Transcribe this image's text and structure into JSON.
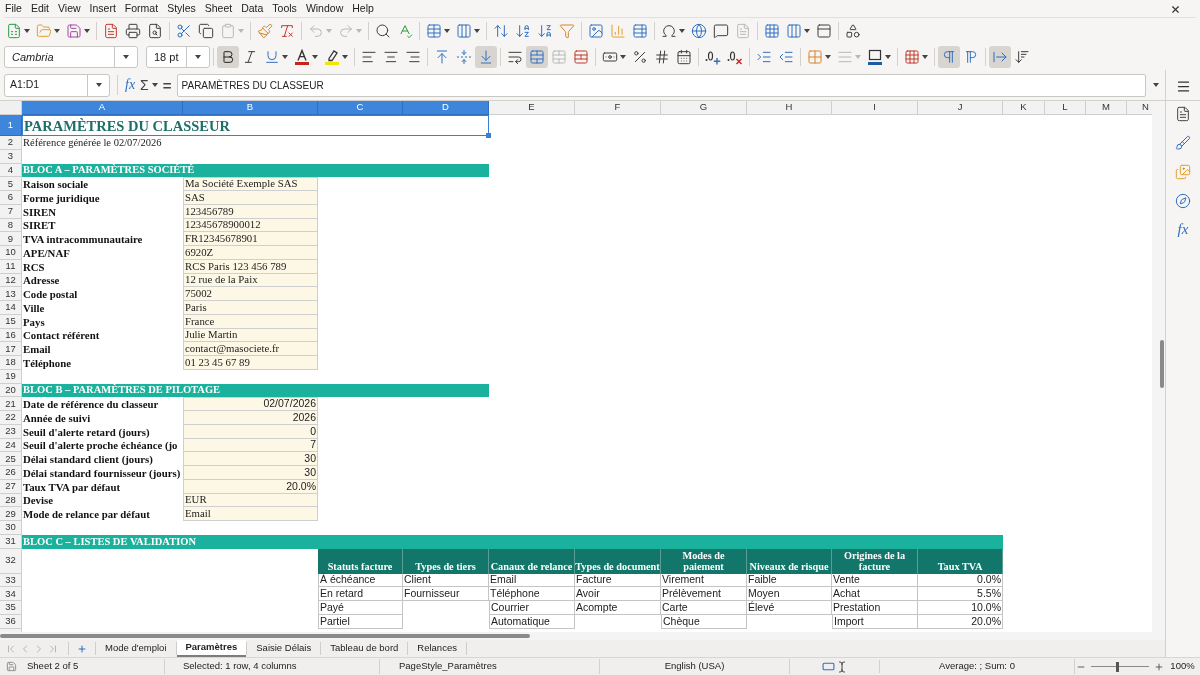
{
  "menu_bar": [
    "File",
    "Edit",
    "View",
    "Insert",
    "Format",
    "Styles",
    "Sheet",
    "Data",
    "Tools",
    "Window",
    "Help"
  ],
  "format_toolbar": {
    "font_name": "Cambria",
    "font_size": "18 pt",
    "toggles": {
      "bold": true,
      "italic": false,
      "underline": false,
      "align_left": false,
      "align_center": false,
      "align_right": false,
      "align_top": false,
      "align_middle": false,
      "align_bottom": true,
      "wrap_text": false,
      "merge_and_center": true,
      "left_to_right": true,
      "right_to_left": false,
      "text_left_to_right": true,
      "text_top_to_bottom": false
    }
  },
  "formula_bar": {
    "name_box": "A1:D1",
    "function_wizard": "fx",
    "sum": "Σ",
    "equals": "=",
    "content": "PARAMÈTRES DU CLASSEUR"
  },
  "sidebar": {
    "functions": "fx"
  },
  "sheet": {
    "columns": [
      {
        "label": "A",
        "selected": true
      },
      {
        "label": "B",
        "selected": true
      },
      {
        "label": "C",
        "selected": true
      },
      {
        "label": "D",
        "selected": true
      },
      {
        "label": "E",
        "selected": false
      },
      {
        "label": "F",
        "selected": false
      },
      {
        "label": "G",
        "selected": false
      },
      {
        "label": "H",
        "selected": false
      },
      {
        "label": "I",
        "selected": false
      },
      {
        "label": "J",
        "selected": false
      },
      {
        "label": "K",
        "selected": false
      },
      {
        "label": "L",
        "selected": false
      },
      {
        "label": "M",
        "selected": false
      },
      {
        "label": "N",
        "selected": false
      }
    ],
    "rows": [
      {
        "label": "1",
        "selected": true
      },
      {
        "label": "2",
        "selected": false
      },
      {
        "label": "3",
        "selected": false
      },
      {
        "label": "4",
        "selected": false
      },
      {
        "label": "5",
        "selected": false
      },
      {
        "label": "6",
        "selected": false
      },
      {
        "label": "7",
        "selected": false
      },
      {
        "label": "8",
        "selected": false
      },
      {
        "label": "9",
        "selected": false
      },
      {
        "label": "10",
        "selected": false
      },
      {
        "label": "11",
        "selected": false
      },
      {
        "label": "12",
        "selected": false
      },
      {
        "label": "13",
        "selected": false
      },
      {
        "label": "14",
        "selected": false
      },
      {
        "label": "15",
        "selected": false
      },
      {
        "label": "16",
        "selected": false
      },
      {
        "label": "17",
        "selected": false
      },
      {
        "label": "18",
        "selected": false
      },
      {
        "label": "19",
        "selected": false
      },
      {
        "label": "20",
        "selected": false
      },
      {
        "label": "21",
        "selected": false
      },
      {
        "label": "22",
        "selected": false
      },
      {
        "label": "23",
        "selected": false
      },
      {
        "label": "24",
        "selected": false
      },
      {
        "label": "25",
        "selected": false
      },
      {
        "label": "26",
        "selected": false
      },
      {
        "label": "27",
        "selected": false
      },
      {
        "label": "28",
        "selected": false
      },
      {
        "label": "29",
        "selected": false
      },
      {
        "label": "30",
        "selected": false
      },
      {
        "label": "31",
        "selected": false
      },
      {
        "label": "32",
        "selected": false
      },
      {
        "label": "33",
        "selected": false
      },
      {
        "label": "34",
        "selected": false
      },
      {
        "label": "35",
        "selected": false
      },
      {
        "label": "36",
        "selected": false
      }
    ],
    "title": {
      "text": "PARAMÈTRES DU CLASSEUR",
      "selected": true
    },
    "subtitle": "Référence générée le 02/07/2026",
    "blocks": [
      {
        "heading": "BLOC A – PARAMÈTRES SOCIÉTÉ",
        "fields": [
          {
            "label": "Raison sociale",
            "value": "Ma Société Exemple SAS",
            "kind": "text"
          },
          {
            "label": "Forme juridique",
            "value": "SAS",
            "kind": "text"
          },
          {
            "label": "SIREN",
            "value": "123456789",
            "kind": "text"
          },
          {
            "label": "SIRET",
            "value": "12345678900012",
            "kind": "text"
          },
          {
            "label": "TVA intracommunautaire",
            "value": "FR12345678901",
            "kind": "text"
          },
          {
            "label": "APE/NAF",
            "value": "6920Z",
            "kind": "text"
          },
          {
            "label": "RCS",
            "value": "RCS Paris 123 456 789",
            "kind": "text"
          },
          {
            "label": "Adresse",
            "value": "12 rue de la Paix",
            "kind": "text"
          },
          {
            "label": "Code postal",
            "value": "75002",
            "kind": "text"
          },
          {
            "label": "Ville",
            "value": "Paris",
            "kind": "text"
          },
          {
            "label": "Pays",
            "value": "France",
            "kind": "text"
          },
          {
            "label": "Contact référent",
            "value": "Julie Martin",
            "kind": "text"
          },
          {
            "label": "Email",
            "value": "contact@masociete.fr",
            "kind": "text"
          },
          {
            "label": "Téléphone",
            "value": "01 23 45 67 89",
            "kind": "text"
          }
        ]
      },
      {
        "heading": "BLOC B – PARAMÈTRES DE PILOTAGE",
        "fields": [
          {
            "label": "Date de référence du classeur",
            "value": "02/07/2026",
            "kind": "number"
          },
          {
            "label": "Année de suivi",
            "value": "2026",
            "kind": "number"
          },
          {
            "label": "Seuil d'alerte retard (jours)",
            "value": "0",
            "kind": "number"
          },
          {
            "label": "Seuil d'alerte proche échéance (jo",
            "value": "7",
            "kind": "number"
          },
          {
            "label": "Délai standard client (jours)",
            "value": "30",
            "kind": "number"
          },
          {
            "label": "Délai standard fournisseur (jours)",
            "value": "30",
            "kind": "number"
          },
          {
            "label": "Taux TVA par défaut",
            "value": "20.0%",
            "kind": "number"
          },
          {
            "label": "Devise",
            "value": "EUR",
            "kind": "text"
          },
          {
            "label": "Mode de relance par défaut",
            "value": "Email",
            "kind": "text"
          }
        ]
      }
    ],
    "validation": {
      "heading": "BLOC C – LISTES DE VALIDATION",
      "lists": [
        {
          "header": "Statuts facture",
          "kind": "text",
          "items": [
            "À échéance",
            "En retard",
            "Payé",
            "Partiel"
          ]
        },
        {
          "header": "Types de tiers",
          "kind": "text",
          "items": [
            "Client",
            "Fournisseur"
          ]
        },
        {
          "header": "Canaux de relance",
          "kind": "text",
          "items": [
            "Email",
            "Téléphone",
            "Courrier",
            "Automatique"
          ]
        },
        {
          "header": "Types de document",
          "kind": "text",
          "items": [
            "Facture",
            "Avoir",
            "Acompte"
          ]
        },
        {
          "header": "Modes de paiement",
          "kind": "text",
          "items": [
            "Virement",
            "Prélèvement",
            "Carte",
            "Chèque"
          ]
        },
        {
          "header": "Niveaux de risque",
          "kind": "text",
          "items": [
            "Faible",
            "Moyen",
            "Élevé"
          ]
        },
        {
          "header": "Origines de la facture",
          "kind": "text",
          "items": [
            "Vente",
            "Achat",
            "Prestation",
            "Import"
          ]
        },
        {
          "header": "Taux TVA",
          "kind": "number",
          "items": [
            "0.0%",
            "5.5%",
            "10.0%",
            "20.0%"
          ]
        }
      ]
    }
  },
  "sheet_tabs": [
    {
      "label": "Mode d'emploi",
      "selected": false
    },
    {
      "label": "Paramètres",
      "selected": true
    },
    {
      "label": "Saisie Délais",
      "selected": false
    },
    {
      "label": "Tableau de bord",
      "selected": false
    },
    {
      "label": "Relances",
      "selected": false
    }
  ],
  "status_bar": {
    "sheet_position": "Sheet 2 of 5",
    "selection": "Selected: 1 row, 4 columns",
    "page_style": "PageStyle_Paramètres",
    "language": "English (USA)",
    "summary": "Average: ; Sum: 0",
    "zoom_slider": {
      "level": 0.45
    },
    "zoom": "100%"
  }
}
